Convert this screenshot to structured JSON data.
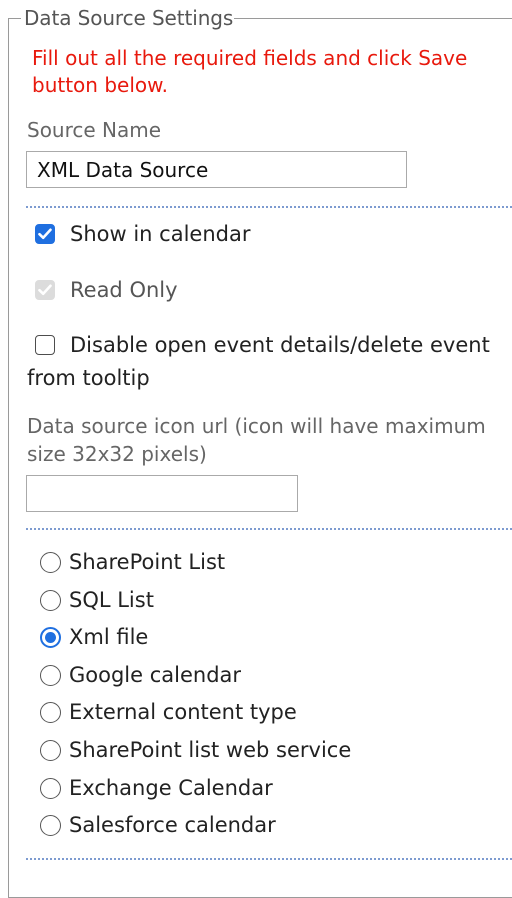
{
  "panel": {
    "legend": "Data Source Settings",
    "required_message": "Fill out all the required fields and click Save button below."
  },
  "source_name": {
    "label": "Source Name",
    "value": "XML Data Source"
  },
  "options": {
    "show_in_calendar": {
      "label": "Show in calendar",
      "checked": true
    },
    "read_only": {
      "label": "Read Only",
      "checked": true,
      "disabled": true
    },
    "disable_tooltip": {
      "label": "Disable open event details/delete event from tooltip",
      "checked": false
    }
  },
  "icon_url": {
    "label": "Data source icon url (icon will have maximum size 32x32 pixels)",
    "value": ""
  },
  "source_types": {
    "selected": "Xml file",
    "items": [
      {
        "label": "SharePoint List"
      },
      {
        "label": "SQL List"
      },
      {
        "label": "Xml file"
      },
      {
        "label": "Google calendar"
      },
      {
        "label": "External content type"
      },
      {
        "label": "SharePoint list web service"
      },
      {
        "label": "Exchange Calendar"
      },
      {
        "label": "Salesforce calendar"
      }
    ]
  },
  "colors": {
    "accent": "#1f6fe0",
    "error_text": "#e8190d",
    "separator": "#7d9bd0"
  },
  "icons": {
    "checkmark": "checkmark-icon"
  }
}
